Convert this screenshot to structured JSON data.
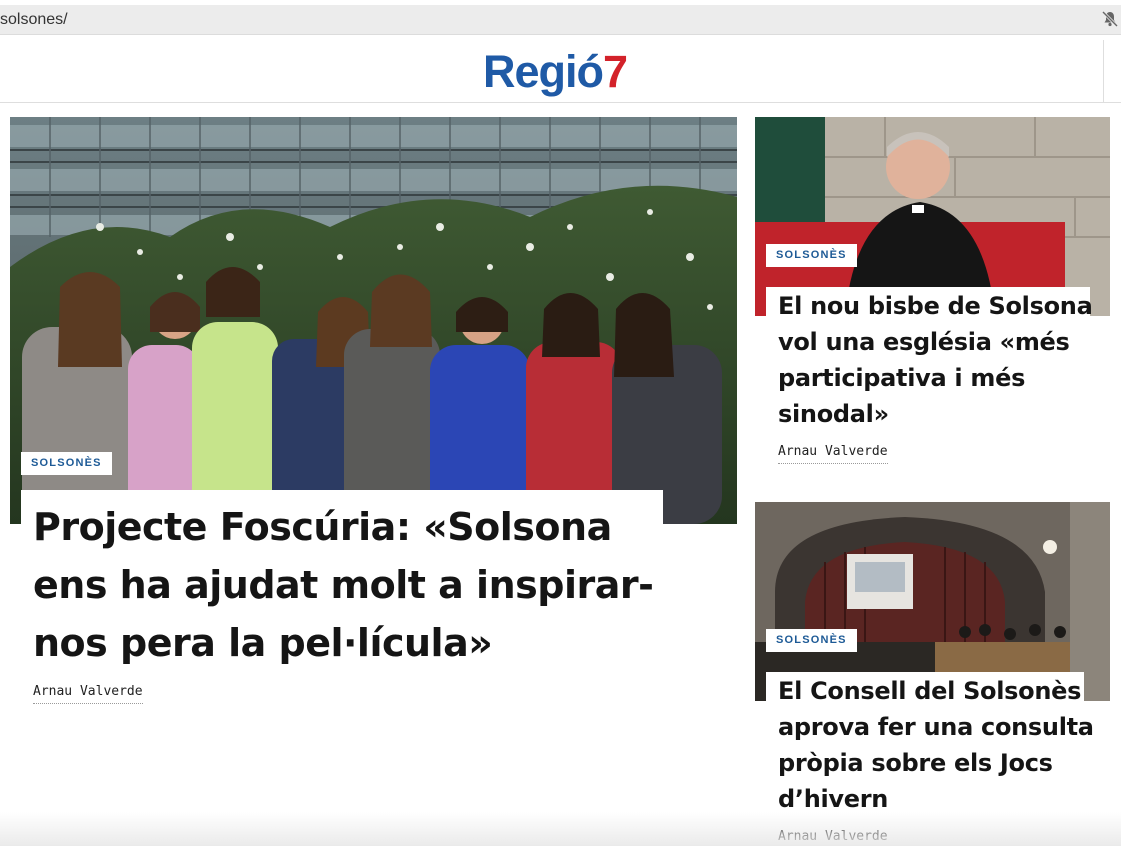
{
  "browser": {
    "url": "solsones/",
    "notification_icon": "bell-slash-icon"
  },
  "header": {
    "logo_word": "Regió",
    "logo_number": "7",
    "colors": {
      "logo_blue": "#1f5aa6",
      "logo_red": "#d3222a"
    }
  },
  "main_story": {
    "tag": "SOLSONÈS",
    "headline_lines": [
      "Projecte Foscúria: «Solsona",
      "ens ha ajudat molt a inspirar-",
      "nos pera la pel·lícula»"
    ],
    "author": "Arnau Valverde"
  },
  "side_stories": [
    {
      "tag": "SOLSONÈS",
      "headline_lines": [
        "El nou bisbe de Solsona",
        "vol una església «més",
        "participativa i més",
        "sinodal»"
      ],
      "author": "Arnau Valverde"
    },
    {
      "tag": "SOLSONÈS",
      "headline_lines": [
        "El Consell del Solsonès",
        "aprova fer una consulta",
        "pròpia sobre els Jocs",
        "d’hivern"
      ],
      "author": "Arnau Valverde"
    }
  ],
  "theme": {
    "tag_color": "#1d5a96"
  }
}
